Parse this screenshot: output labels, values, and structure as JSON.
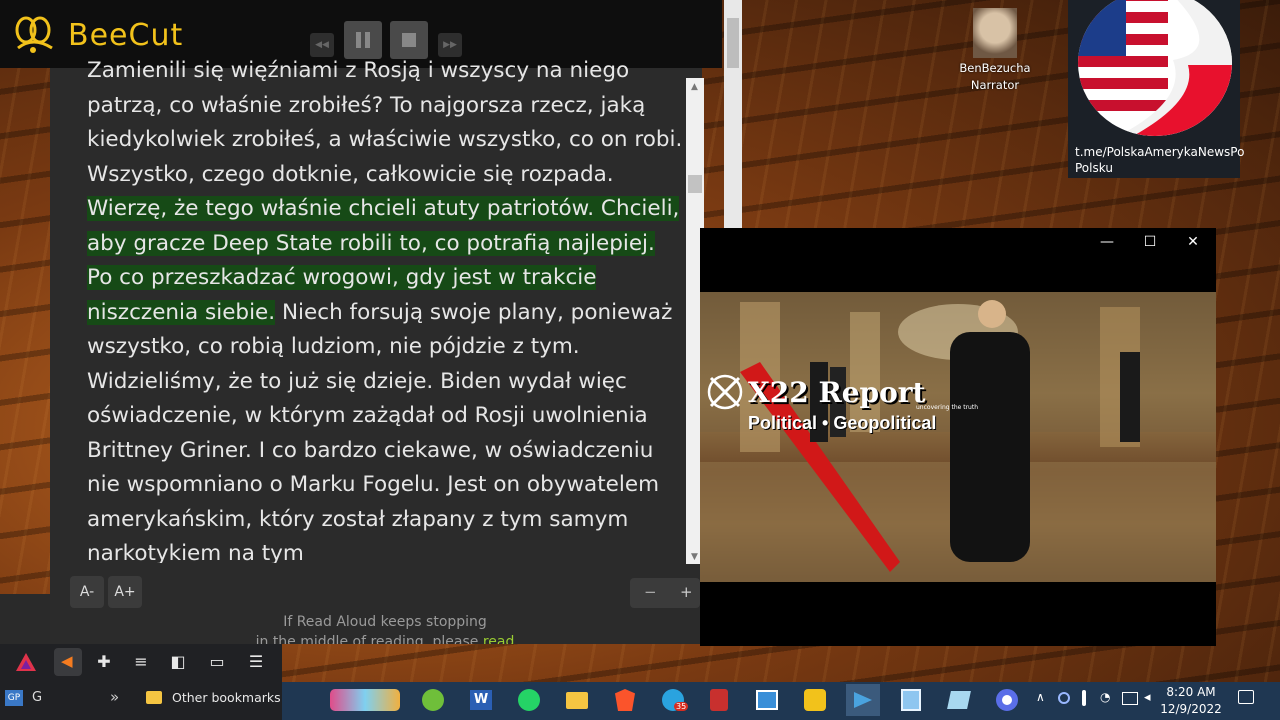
{
  "beecut": {
    "brand": "BeeCut",
    "brand_color": "#f2c21b"
  },
  "reader": {
    "text_before": "Zamienili się więźniami z Rosją i wszyscy na niego patrzą, co właśnie zrobiłeś? To najgorsza rzecz, jaką kiedykolwiek zrobiłeś, a właściwie wszystko, co on robi. Wszystko, czego dotknie, całkowicie się rozpada. ",
    "text_highlight": "Wierzę, że tego właśnie chcieli atuty patriotów. Chcieli, aby gracze Deep State robili to, co potrafią najlepiej. Po co przeszkadzać wrogowi, gdy jest w trakcie niszczenia siebie.",
    "text_after": " Niech forsują swoje plany, ponieważ wszystko, co robią ludziom, nie pójdzie z tym. Widzieliśmy, że to już się dzieje. Biden wydał więc oświadczenie, w którym zażądał od Rosji uwolnienia Brittney Griner. I co bardzo ciekawe, w oświadczeniu nie wspomniano o Marku Fogelu. Jest on obywatelem amerykańskim, który został złapany z tym samym narkotykiem na tym",
    "highlight_color": "#164a16",
    "font_decrease": "A-",
    "font_increase": "A+",
    "speed_minus": "−",
    "speed_plus": "+",
    "hint_line1": "If Read Aloud keeps stopping",
    "hint_line2": "in the middle of reading, please ",
    "hint_link": "read"
  },
  "narrator": {
    "name": "BenBezucha",
    "role": "Narrator"
  },
  "channel": {
    "line1": "t.me/PolskaAmerykaNewsPo",
    "line2": "Polsku"
  },
  "video": {
    "title": "X22 Report",
    "tagline": "uncovering the truth",
    "subtitle": "Political • Geopolitical",
    "minimize": "—",
    "maximize": "☐",
    "close": "✕"
  },
  "browser": {
    "profile_initial": "G",
    "overflow": "»",
    "other_bookmarks": "Other bookmarks"
  },
  "taskbar": {
    "time": "8:20 AM",
    "date": "12/9/2022",
    "telegram_badge": "35",
    "icons": [
      "game-icon",
      "green-app-icon",
      "word-icon",
      "whatsapp-icon",
      "file-explorer-icon",
      "brave-icon",
      "telegram-icon",
      "paint-tool-icon",
      "photos-icon",
      "beecut-icon",
      "video-player-icon",
      "notepad-icon",
      "app-icon",
      "chrome-icon"
    ]
  }
}
